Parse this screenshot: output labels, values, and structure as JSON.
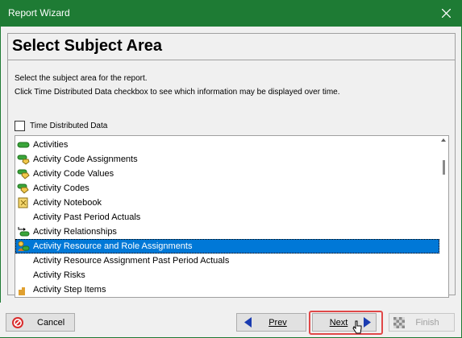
{
  "window": {
    "title": "Report Wizard"
  },
  "page": {
    "heading": "Select Subject Area",
    "desc_line1": "Select the subject area for the report.",
    "desc_line2": "Click Time Distributed Data checkbox to see which information may be displayed over time.",
    "checkbox_label": "Time Distributed Data",
    "checkbox_checked": false
  },
  "list": {
    "items": [
      {
        "label": "Activities",
        "icon": "activity-bar-icon"
      },
      {
        "label": "Activity Code Assignments",
        "icon": "activity-code-assign-icon"
      },
      {
        "label": "Activity Code Values",
        "icon": "activity-code-values-icon"
      },
      {
        "label": "Activity Codes",
        "icon": "activity-codes-icon"
      },
      {
        "label": "Activity Notebook",
        "icon": "notebook-icon"
      },
      {
        "label": "Activity Past Period Actuals",
        "icon": ""
      },
      {
        "label": "Activity Relationships",
        "icon": "relationship-icon"
      },
      {
        "label": "Activity Resource and Role Assignments",
        "icon": "resource-assign-icon",
        "selected": true
      },
      {
        "label": "Activity Resource Assignment Past Period Actuals",
        "icon": ""
      },
      {
        "label": "Activity Risks",
        "icon": ""
      },
      {
        "label": "Activity Step Items",
        "icon": "step-items-icon"
      }
    ]
  },
  "buttons": {
    "cancel": "Cancel",
    "prev": "Prev",
    "next": "Next",
    "finish": "Finish"
  },
  "colors": {
    "titlebar": "#1e7b34",
    "selection": "#0078d7",
    "highlight": "#e04848"
  }
}
